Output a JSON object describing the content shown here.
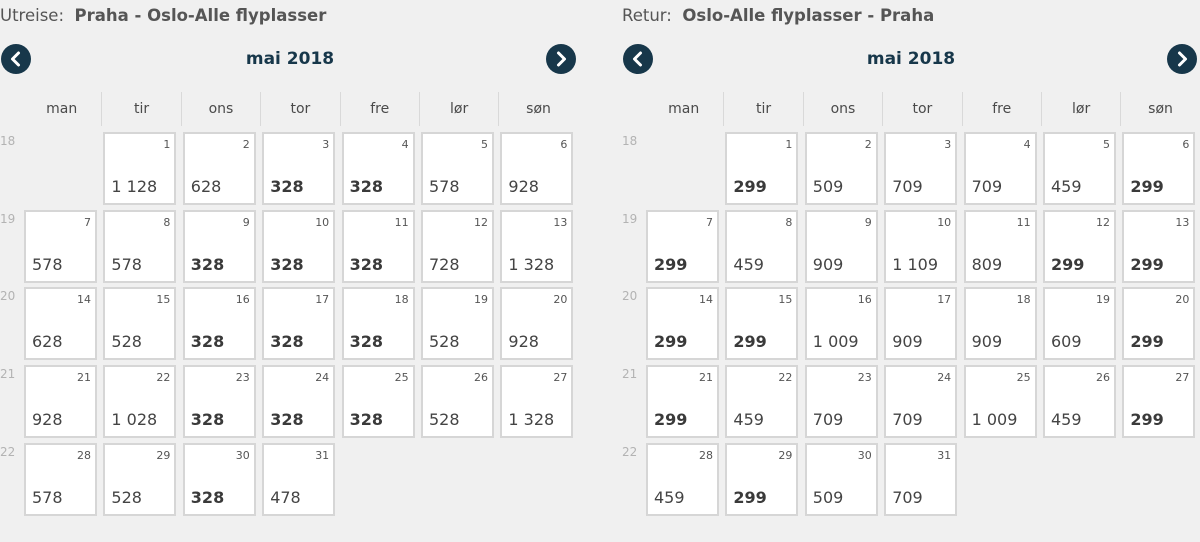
{
  "outbound": {
    "label": "Utreise:",
    "route": "Praha - Oslo-Alle flyplasser",
    "month": "mai 2018",
    "weekdays": [
      "man",
      "tir",
      "ons",
      "tor",
      "fre",
      "lør",
      "søn"
    ],
    "weeks": [
      "18",
      "19",
      "20",
      "21",
      "22"
    ],
    "cells": [
      {
        "day": "1",
        "price": "1 128",
        "cheap": false
      },
      {
        "day": "2",
        "price": "628",
        "cheap": false
      },
      {
        "day": "3",
        "price": "328",
        "cheap": true
      },
      {
        "day": "4",
        "price": "328",
        "cheap": true
      },
      {
        "day": "5",
        "price": "578",
        "cheap": false
      },
      {
        "day": "6",
        "price": "928",
        "cheap": false
      },
      {
        "day": "7",
        "price": "578",
        "cheap": false
      },
      {
        "day": "8",
        "price": "578",
        "cheap": false
      },
      {
        "day": "9",
        "price": "328",
        "cheap": true
      },
      {
        "day": "10",
        "price": "328",
        "cheap": true
      },
      {
        "day": "11",
        "price": "328",
        "cheap": true
      },
      {
        "day": "12",
        "price": "728",
        "cheap": false
      },
      {
        "day": "13",
        "price": "1 328",
        "cheap": false
      },
      {
        "day": "14",
        "price": "628",
        "cheap": false
      },
      {
        "day": "15",
        "price": "528",
        "cheap": false
      },
      {
        "day": "16",
        "price": "328",
        "cheap": true
      },
      {
        "day": "17",
        "price": "328",
        "cheap": true
      },
      {
        "day": "18",
        "price": "328",
        "cheap": true
      },
      {
        "day": "19",
        "price": "528",
        "cheap": false
      },
      {
        "day": "20",
        "price": "928",
        "cheap": false
      },
      {
        "day": "21",
        "price": "928",
        "cheap": false
      },
      {
        "day": "22",
        "price": "1 028",
        "cheap": false
      },
      {
        "day": "23",
        "price": "328",
        "cheap": true
      },
      {
        "day": "24",
        "price": "328",
        "cheap": true
      },
      {
        "day": "25",
        "price": "328",
        "cheap": true
      },
      {
        "day": "26",
        "price": "528",
        "cheap": false
      },
      {
        "day": "27",
        "price": "1 328",
        "cheap": false
      },
      {
        "day": "28",
        "price": "578",
        "cheap": false
      },
      {
        "day": "29",
        "price": "528",
        "cheap": false
      },
      {
        "day": "30",
        "price": "328",
        "cheap": true
      },
      {
        "day": "31",
        "price": "478",
        "cheap": false
      }
    ]
  },
  "return": {
    "label": "Retur:",
    "route": "Oslo-Alle flyplasser - Praha",
    "month": "mai 2018",
    "weekdays": [
      "man",
      "tir",
      "ons",
      "tor",
      "fre",
      "lør",
      "søn"
    ],
    "weeks": [
      "18",
      "19",
      "20",
      "21",
      "22"
    ],
    "cells": [
      {
        "day": "1",
        "price": "299",
        "cheap": true
      },
      {
        "day": "2",
        "price": "509",
        "cheap": false
      },
      {
        "day": "3",
        "price": "709",
        "cheap": false
      },
      {
        "day": "4",
        "price": "709",
        "cheap": false
      },
      {
        "day": "5",
        "price": "459",
        "cheap": false
      },
      {
        "day": "6",
        "price": "299",
        "cheap": true
      },
      {
        "day": "7",
        "price": "299",
        "cheap": true
      },
      {
        "day": "8",
        "price": "459",
        "cheap": false
      },
      {
        "day": "9",
        "price": "909",
        "cheap": false
      },
      {
        "day": "10",
        "price": "1 109",
        "cheap": false
      },
      {
        "day": "11",
        "price": "809",
        "cheap": false
      },
      {
        "day": "12",
        "price": "299",
        "cheap": true
      },
      {
        "day": "13",
        "price": "299",
        "cheap": true
      },
      {
        "day": "14",
        "price": "299",
        "cheap": true
      },
      {
        "day": "15",
        "price": "299",
        "cheap": true
      },
      {
        "day": "16",
        "price": "1 009",
        "cheap": false
      },
      {
        "day": "17",
        "price": "909",
        "cheap": false
      },
      {
        "day": "18",
        "price": "909",
        "cheap": false
      },
      {
        "day": "19",
        "price": "609",
        "cheap": false
      },
      {
        "day": "20",
        "price": "299",
        "cheap": true
      },
      {
        "day": "21",
        "price": "299",
        "cheap": true
      },
      {
        "day": "22",
        "price": "459",
        "cheap": false
      },
      {
        "day": "23",
        "price": "709",
        "cheap": false
      },
      {
        "day": "24",
        "price": "709",
        "cheap": false
      },
      {
        "day": "25",
        "price": "1 009",
        "cheap": false
      },
      {
        "day": "26",
        "price": "459",
        "cheap": false
      },
      {
        "day": "27",
        "price": "299",
        "cheap": true
      },
      {
        "day": "28",
        "price": "459",
        "cheap": false
      },
      {
        "day": "29",
        "price": "299",
        "cheap": true
      },
      {
        "day": "30",
        "price": "509",
        "cheap": false
      },
      {
        "day": "31",
        "price": "709",
        "cheap": false
      }
    ]
  },
  "icons": {
    "prev": "chevron-left-icon",
    "next": "chevron-right-icon"
  },
  "colors": {
    "accent": "#17374a",
    "background": "#f0f0f0"
  }
}
